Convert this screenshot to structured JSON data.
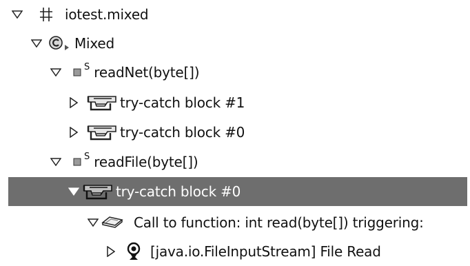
{
  "tree": {
    "nodes": [
      {
        "label": "iotest.mixed",
        "expanded": true,
        "icon": "package-icon",
        "depth": 0
      },
      {
        "label": "Mixed",
        "expanded": true,
        "icon": "class-icon",
        "depth": 1
      },
      {
        "label": "readNet(byte[])",
        "modifier": "S",
        "expanded": true,
        "icon": "method-icon",
        "depth": 2
      },
      {
        "label": "try-catch block #1",
        "expanded": false,
        "icon": "try-catch-icon",
        "depth": 3
      },
      {
        "label": "try-catch block #0",
        "expanded": false,
        "icon": "try-catch-icon",
        "depth": 3
      },
      {
        "label": "readFile(byte[])",
        "modifier": "S",
        "expanded": true,
        "icon": "method-icon",
        "depth": 2
      },
      {
        "label": "try-catch block #0",
        "expanded": true,
        "icon": "try-catch-icon",
        "depth": 3,
        "selected": true
      },
      {
        "label": "Call to function: int read(byte[])  triggering:",
        "expanded": true,
        "icon": "call-icon",
        "depth": 4
      },
      {
        "label": "[java.io.FileInputStream]  File Read",
        "expanded": false,
        "icon": "exception-icon",
        "depth": 5
      }
    ]
  }
}
